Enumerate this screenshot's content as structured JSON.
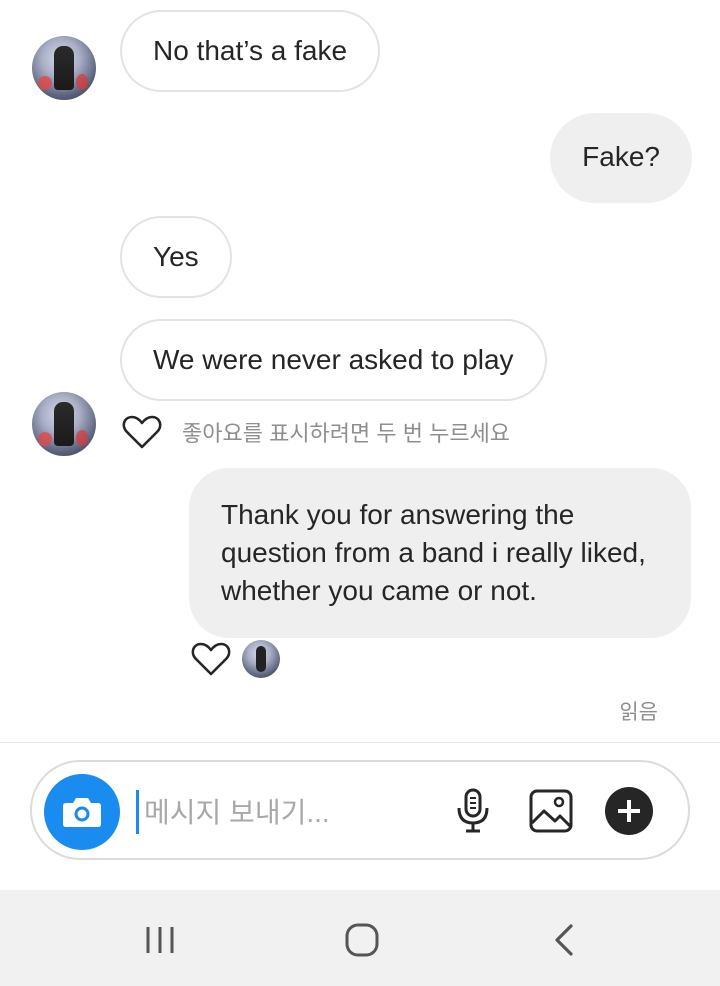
{
  "messages": {
    "m1": "No that’s a fake",
    "m2": "Fake?",
    "m3": "Yes",
    "m4": "We were never asked to play",
    "m5": "Thank you for answering the question from a band i really liked, whether you came or not."
  },
  "like_hint": "좋아요를 표시하려면 두 번 누르세요",
  "seen_label": "읽음",
  "composer": {
    "placeholder": "메시지 보내기..."
  },
  "icons": {
    "camera": "camera-icon",
    "mic": "microphone-icon",
    "gallery": "gallery-icon",
    "add": "plus-icon",
    "heart": "heart-outline-icon",
    "nav_recent": "recent-apps-icon",
    "nav_home": "home-icon",
    "nav_back": "back-icon"
  },
  "colors": {
    "accent": "#1a8cf0",
    "incoming_border": "#e3e3e3",
    "outgoing_bg": "#efefef",
    "muted_text": "#8e8e8e"
  }
}
